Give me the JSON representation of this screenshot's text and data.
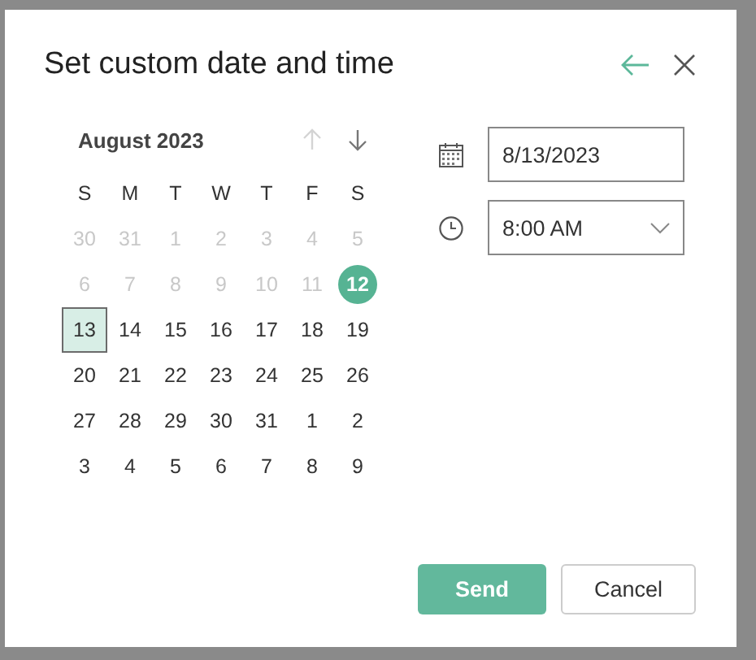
{
  "dialog": {
    "title": "Set custom date and time"
  },
  "calendar": {
    "month_label": "August 2023",
    "prev_month": {
      "disabled": true
    },
    "next_month": {
      "disabled": false
    },
    "weekdays": [
      "S",
      "M",
      "T",
      "W",
      "T",
      "F",
      "S"
    ],
    "days": [
      {
        "text": "30",
        "disabled": true,
        "today": false,
        "selected": false
      },
      {
        "text": "31",
        "disabled": true,
        "today": false,
        "selected": false
      },
      {
        "text": "1",
        "disabled": true,
        "today": false,
        "selected": false
      },
      {
        "text": "2",
        "disabled": true,
        "today": false,
        "selected": false
      },
      {
        "text": "3",
        "disabled": true,
        "today": false,
        "selected": false
      },
      {
        "text": "4",
        "disabled": true,
        "today": false,
        "selected": false
      },
      {
        "text": "5",
        "disabled": true,
        "today": false,
        "selected": false
      },
      {
        "text": "6",
        "disabled": true,
        "today": false,
        "selected": false
      },
      {
        "text": "7",
        "disabled": true,
        "today": false,
        "selected": false
      },
      {
        "text": "8",
        "disabled": true,
        "today": false,
        "selected": false
      },
      {
        "text": "9",
        "disabled": true,
        "today": false,
        "selected": false
      },
      {
        "text": "10",
        "disabled": true,
        "today": false,
        "selected": false
      },
      {
        "text": "11",
        "disabled": true,
        "today": false,
        "selected": false
      },
      {
        "text": "12",
        "disabled": false,
        "today": true,
        "selected": false
      },
      {
        "text": "13",
        "disabled": false,
        "today": false,
        "selected": true
      },
      {
        "text": "14",
        "disabled": false,
        "today": false,
        "selected": false
      },
      {
        "text": "15",
        "disabled": false,
        "today": false,
        "selected": false
      },
      {
        "text": "16",
        "disabled": false,
        "today": false,
        "selected": false
      },
      {
        "text": "17",
        "disabled": false,
        "today": false,
        "selected": false
      },
      {
        "text": "18",
        "disabled": false,
        "today": false,
        "selected": false
      },
      {
        "text": "19",
        "disabled": false,
        "today": false,
        "selected": false
      },
      {
        "text": "20",
        "disabled": false,
        "today": false,
        "selected": false
      },
      {
        "text": "21",
        "disabled": false,
        "today": false,
        "selected": false
      },
      {
        "text": "22",
        "disabled": false,
        "today": false,
        "selected": false
      },
      {
        "text": "23",
        "disabled": false,
        "today": false,
        "selected": false
      },
      {
        "text": "24",
        "disabled": false,
        "today": false,
        "selected": false
      },
      {
        "text": "25",
        "disabled": false,
        "today": false,
        "selected": false
      },
      {
        "text": "26",
        "disabled": false,
        "today": false,
        "selected": false
      },
      {
        "text": "27",
        "disabled": false,
        "today": false,
        "selected": false
      },
      {
        "text": "28",
        "disabled": false,
        "today": false,
        "selected": false
      },
      {
        "text": "29",
        "disabled": false,
        "today": false,
        "selected": false
      },
      {
        "text": "30",
        "disabled": false,
        "today": false,
        "selected": false
      },
      {
        "text": "31",
        "disabled": false,
        "today": false,
        "selected": false
      },
      {
        "text": "1",
        "disabled": false,
        "today": false,
        "selected": false
      },
      {
        "text": "2",
        "disabled": false,
        "today": false,
        "selected": false
      },
      {
        "text": "3",
        "disabled": false,
        "today": false,
        "selected": false
      },
      {
        "text": "4",
        "disabled": false,
        "today": false,
        "selected": false
      },
      {
        "text": "5",
        "disabled": false,
        "today": false,
        "selected": false
      },
      {
        "text": "6",
        "disabled": false,
        "today": false,
        "selected": false
      },
      {
        "text": "7",
        "disabled": false,
        "today": false,
        "selected": false
      },
      {
        "text": "8",
        "disabled": false,
        "today": false,
        "selected": false
      },
      {
        "text": "9",
        "disabled": false,
        "today": false,
        "selected": false
      }
    ]
  },
  "date_field": {
    "value": "8/13/2023"
  },
  "time_field": {
    "value": "8:00 AM"
  },
  "buttons": [
    {
      "label": "Send",
      "kind": "primary"
    },
    {
      "label": "Cancel",
      "kind": "secondary"
    }
  ]
}
